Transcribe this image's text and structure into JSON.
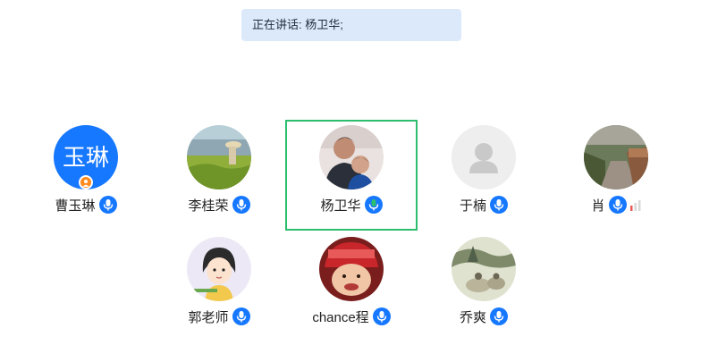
{
  "banner": {
    "text": "正在讲话: 杨卫华;"
  },
  "participants": [
    {
      "name": "曹玉琳",
      "avatar_text": "玉琳",
      "host": true,
      "speaking": false
    },
    {
      "name": "李桂荣",
      "speaking": false
    },
    {
      "name": "杨卫华",
      "speaking": true
    },
    {
      "name": "于楠",
      "speaking": false,
      "default_avatar": true
    },
    {
      "name": "肖",
      "speaking": false,
      "signal": true
    },
    {
      "name": "郭老师",
      "speaking": false
    },
    {
      "name": "chance程",
      "speaking": false
    },
    {
      "name": "乔爽",
      "speaking": false
    }
  ],
  "colors": {
    "accent": "#1677ff",
    "speaking_border": "#2dbd6e",
    "speaking_mic": "#2dbd6e",
    "host_badge": "#ff8a1f",
    "banner_bg": "#dbe9fb"
  }
}
